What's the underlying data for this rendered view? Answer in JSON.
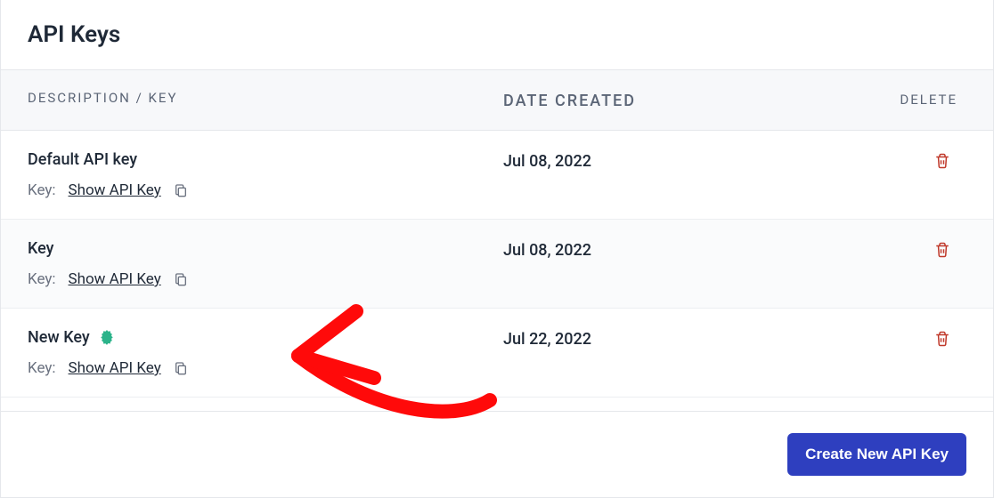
{
  "panel": {
    "title": "API Keys"
  },
  "columns": {
    "desc": "DESCRIPTION / KEY",
    "date": "DATE CREATED",
    "delete": "DELETE"
  },
  "labels": {
    "key_prefix": "Key:",
    "show_api_key": "Show API Key"
  },
  "rows": [
    {
      "name": "Default API key",
      "date": "Jul 08, 2022",
      "is_new": false
    },
    {
      "name": "Key",
      "date": "Jul 08, 2022",
      "is_new": false
    },
    {
      "name": "New Key",
      "date": "Jul 22, 2022",
      "is_new": true
    }
  ],
  "footer": {
    "create_button": "Create New API Key"
  },
  "colors": {
    "primary": "#2e3fbf",
    "danger": "#c0392b",
    "badge": "#2bb38a"
  }
}
